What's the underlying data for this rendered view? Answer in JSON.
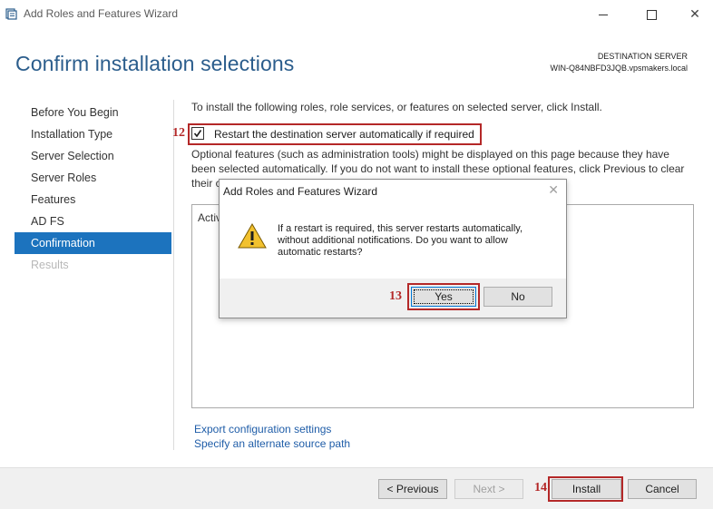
{
  "window": {
    "title": "Add Roles and Features Wizard",
    "controls": {
      "minimize": "minimize-icon",
      "maximize": "maximize-icon",
      "close": "close-icon"
    }
  },
  "header": {
    "page_title": "Confirm installation selections",
    "destination_label": "DESTINATION SERVER",
    "destination_value": "WIN-Q84NBFD3JQB.vpsmakers.local"
  },
  "sidebar": {
    "items": [
      {
        "label": "Before You Begin",
        "state": "normal"
      },
      {
        "label": "Installation Type",
        "state": "normal"
      },
      {
        "label": "Server Selection",
        "state": "normal"
      },
      {
        "label": "Server Roles",
        "state": "normal"
      },
      {
        "label": "Features",
        "state": "normal"
      },
      {
        "label": "AD FS",
        "state": "normal"
      },
      {
        "label": "Confirmation",
        "state": "active"
      },
      {
        "label": "Results",
        "state": "disabled"
      }
    ]
  },
  "content": {
    "intro": "To install the following roles, role services, or features on selected server, click Install.",
    "restart_checkbox_label": "Restart the destination server automatically if required",
    "restart_checked": true,
    "optional_text_line1": "Optional features (such as administration tools) might be displayed on this page because they have",
    "optional_text_line2": "been selected automatically. If you do not want to install these optional features, click Previous to clear",
    "optional_text_line3": "their c",
    "listbox_text": "Activ",
    "link_export": "Export configuration settings",
    "link_alternate": "Specify an alternate source path"
  },
  "footer": {
    "previous": "< Previous",
    "next": "Next >",
    "install": "Install",
    "cancel": "Cancel"
  },
  "dialog": {
    "title": "Add Roles and Features Wizard",
    "icon": "warning-icon",
    "message": "If a restart is required, this server restarts automatically, without additional notifications. Do you want to allow automatic restarts?",
    "yes": "Yes",
    "no": "No"
  },
  "annotations": {
    "step_12": "12",
    "step_13": "13",
    "step_14": "14",
    "highlight_color": "#b42828"
  },
  "colors": {
    "title_blue": "#2b5d8c",
    "active_nav": "#1c73be",
    "link": "#1f5da8"
  }
}
